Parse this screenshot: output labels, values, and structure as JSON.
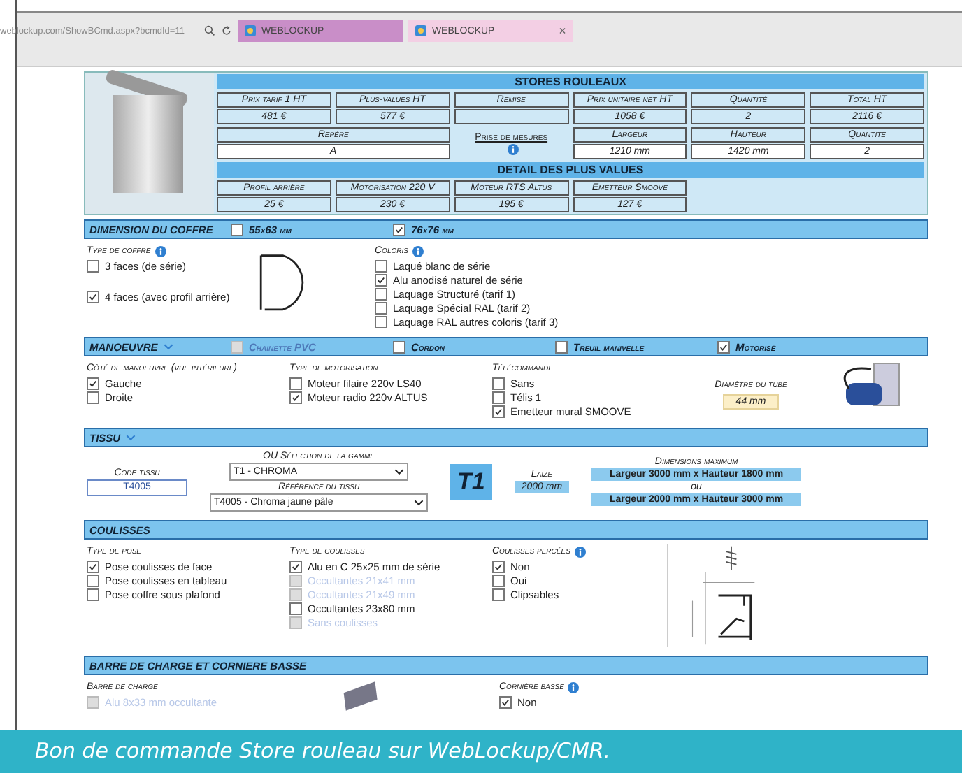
{
  "browser": {
    "url": "weblockup.com/ShowBCmd.aspx?bcmdId=11",
    "tabs": [
      {
        "label": "WEBLOCKUP",
        "selected": true
      },
      {
        "label": "WEBLOCKUP",
        "selected": false,
        "close": "×"
      }
    ]
  },
  "summary": {
    "title": "STORES ROULEAUX",
    "row_1": [
      {
        "label": "Prix tarif 1 HT",
        "value": "481 €"
      },
      {
        "label": "Plus-values HT",
        "value": "577 €"
      },
      {
        "label": "Remise"
      },
      {
        "label": "Prix unitaire net HT",
        "value": "1058 €"
      },
      {
        "label": "Quantité",
        "value": "2"
      },
      {
        "label": "Total HT",
        "value": "2116 €"
      }
    ],
    "reference": {
      "label": "Repère",
      "value": "A"
    },
    "measure_link": "Prise de mesures",
    "row_2": [
      {
        "label": "Largeur",
        "value": "1210 mm"
      },
      {
        "label": "Hauteur",
        "value": "1420 mm"
      },
      {
        "label": "Quantité",
        "value": "2"
      }
    ],
    "detail_title": "DETAIL DES PLUS VALUES",
    "details": [
      {
        "label": "Profil arrière",
        "value": "25 €"
      },
      {
        "label": "Motorisation 220 V",
        "value": "230 €"
      },
      {
        "label": "Moteur RTS Altus",
        "value": "195 €"
      },
      {
        "label": "Emetteur Smoove",
        "value": "127 €"
      }
    ]
  },
  "coffre": {
    "title": "DIMENSION DU COFFRE",
    "header_options": [
      {
        "label": "55x63 mm",
        "checked": false,
        "disabled": false
      },
      {
        "label": "76x76 mm",
        "checked": true,
        "disabled": false
      }
    ],
    "type": {
      "title": "Type de coffre",
      "info": true,
      "options": [
        {
          "label": "3 faces (de série)",
          "checked": false,
          "disabled": false
        },
        {
          "label": "4 faces (avec profil arrière)",
          "checked": true,
          "disabled": false
        }
      ]
    },
    "colors": {
      "title": "Coloris",
      "info": true,
      "options": [
        {
          "label": "Laqué blanc de série",
          "checked": false,
          "disabled": false
        },
        {
          "label": "Alu anodisé naturel de série",
          "checked": true,
          "disabled": false
        },
        {
          "label": "Laquage Structuré (tarif 1)",
          "checked": false,
          "disabled": false
        },
        {
          "label": "Laquage Spécial RAL (tarif 2)",
          "checked": false,
          "disabled": false
        },
        {
          "label": "Laquage RAL autres coloris (tarif 3)",
          "checked": false,
          "disabled": false
        }
      ]
    }
  },
  "manoeuvre": {
    "title": "MANOEUVRE",
    "header_options": [
      {
        "label": "Chainette PVC",
        "checked": false,
        "disabled": true
      },
      {
        "label": "Cordon",
        "checked": false,
        "disabled": false
      },
      {
        "label": "Treuil manivelle",
        "checked": false,
        "disabled": false
      },
      {
        "label": "Motorisé",
        "checked": true,
        "disabled": false
      }
    ],
    "columns": [
      {
        "title": "Côté de manoeuvre (vue intérieure)",
        "info": false,
        "options": [
          {
            "label": "Gauche",
            "checked": true,
            "disabled": false
          },
          {
            "label": "Droite",
            "checked": false,
            "disabled": false
          }
        ]
      },
      {
        "title": "Type de motorisation",
        "info": false,
        "options": [
          {
            "label": "Moteur filaire 220v LS40",
            "checked": false,
            "disabled": false
          },
          {
            "label": "Moteur radio 220v ALTUS",
            "checked": true,
            "disabled": false
          }
        ]
      },
      {
        "title": "Télécommande",
        "info": false,
        "options": [
          {
            "label": "Sans",
            "checked": false,
            "disabled": false
          },
          {
            "label": "Télis 1",
            "checked": false,
            "disabled": false
          },
          {
            "label": "Emetteur mural SMOOVE",
            "checked": true,
            "disabled": false
          }
        ]
      }
    ],
    "tube": {
      "label": "Diamètre du tube",
      "value": "44 mm"
    }
  },
  "tissu": {
    "title": "TISSU",
    "code": {
      "label": "Code tissu",
      "value": "T4005"
    },
    "range": {
      "label": "OU Sélection de la gamme",
      "value": "T1 - CHROMA"
    },
    "reference": {
      "label": "Référence du tissu",
      "value": "T4005 - Chroma jaune pâle"
    },
    "badge": "T1",
    "laize": {
      "label": "Laize",
      "value": "2000 mm"
    },
    "max": {
      "label": "Dimensions maximum",
      "first": "Largeur 3000 mm x Hauteur 1800 mm",
      "separator": "ou",
      "second": "Largeur 2000 mm x Hauteur 3000 mm"
    }
  },
  "coulisses": {
    "title": "COULISSES",
    "columns": [
      {
        "title": "Type de pose",
        "info": false,
        "options": [
          {
            "label": "Pose coulisses de face",
            "checked": true,
            "disabled": false
          },
          {
            "label": "Pose coulisses en tableau",
            "checked": false,
            "disabled": false
          },
          {
            "label": "Pose coffre sous plafond",
            "checked": false,
            "disabled": false
          }
        ]
      },
      {
        "title": "Type de coulisses",
        "info": false,
        "options": [
          {
            "label": "Alu en C 25x25 mm de série",
            "checked": true,
            "disabled": false
          },
          {
            "label": "Occultantes 21x41 mm",
            "checked": false,
            "disabled": true
          },
          {
            "label": "Occultantes 21x49 mm",
            "checked": false,
            "disabled": true
          },
          {
            "label": "Occultantes 23x80 mm",
            "checked": false,
            "disabled": false
          },
          {
            "label": "Sans coulisses",
            "checked": false,
            "disabled": true
          }
        ]
      },
      {
        "title": "Coulisses percées",
        "info": true,
        "options": [
          {
            "label": "Non",
            "checked": true,
            "disabled": false
          },
          {
            "label": "Oui",
            "checked": false,
            "disabled": false
          },
          {
            "label": "Clipsables",
            "checked": false,
            "disabled": false
          }
        ]
      }
    ]
  },
  "barre": {
    "title": "BARRE DE CHARGE ET CORNIERE BASSE",
    "columns": [
      {
        "title": "Barre de charge",
        "info": false,
        "options": [
          {
            "label": "Alu 8x33 mm occultante",
            "checked": false,
            "disabled": true
          }
        ]
      },
      {
        "title": "Cornière basse",
        "info": true,
        "options": [
          {
            "label": "Non",
            "checked": true,
            "disabled": false
          }
        ]
      }
    ]
  },
  "caption": "Bon de commande Store rouleau sur WebLockup/CMR."
}
